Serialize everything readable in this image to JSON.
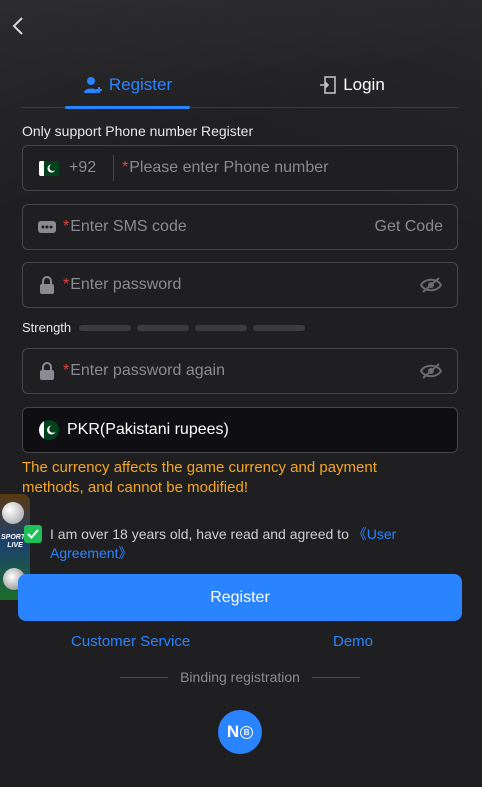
{
  "tabs": {
    "register": "Register",
    "login": "Login"
  },
  "notice": "Only support Phone number Register",
  "phone": {
    "country_code": "+92",
    "required_mark": "*",
    "placeholder": "Please enter Phone number"
  },
  "sms": {
    "required_mark": "*",
    "placeholder": "Enter SMS code",
    "get_code": "Get Code"
  },
  "password": {
    "required_mark": "*",
    "placeholder": "Enter password"
  },
  "strength": {
    "label": "Strength",
    "level": 0,
    "segments": 4
  },
  "password_again": {
    "required_mark": "*",
    "placeholder": "Enter password again"
  },
  "currency": {
    "label": "PKR(Pakistani rupees)"
  },
  "warning": "The currency affects the game currency and payment methods, and cannot be modified!",
  "agreement": {
    "checked": true,
    "text": "I am over 18 years old, have read and agreed to ",
    "link": "《User Agreement》"
  },
  "promo": {
    "text": "SPORTS LIVE"
  },
  "register_button": "Register",
  "links": {
    "customer_service": "Customer Service",
    "demo": "Demo"
  },
  "binding_label": "Binding registration",
  "logo": {
    "text": "N",
    "badge": "B"
  },
  "colors": {
    "accent": "#2a84ff",
    "warning": "#f5a623",
    "required": "#e0443e",
    "checkbox": "#1fbe58",
    "background": "#1f1f22"
  },
  "icons": {
    "back": "chevron-left-icon",
    "register_tab": "user-add-icon",
    "login_tab": "login-door-icon",
    "sms": "message-dots-icon",
    "password": "lock-icon",
    "visibility": "eye-off-icon",
    "flag": "pakistan-flag-icon",
    "check": "check-icon"
  }
}
